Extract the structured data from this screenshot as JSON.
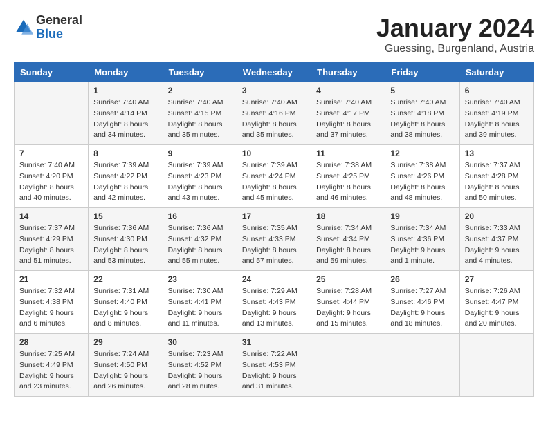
{
  "header": {
    "logo_general": "General",
    "logo_blue": "Blue",
    "month_title": "January 2024",
    "subtitle": "Guessing, Burgenland, Austria"
  },
  "days_of_week": [
    "Sunday",
    "Monday",
    "Tuesday",
    "Wednesday",
    "Thursday",
    "Friday",
    "Saturday"
  ],
  "weeks": [
    [
      {
        "day": "",
        "sunrise": "",
        "sunset": "",
        "daylight": ""
      },
      {
        "day": "1",
        "sunrise": "Sunrise: 7:40 AM",
        "sunset": "Sunset: 4:14 PM",
        "daylight": "Daylight: 8 hours and 34 minutes."
      },
      {
        "day": "2",
        "sunrise": "Sunrise: 7:40 AM",
        "sunset": "Sunset: 4:15 PM",
        "daylight": "Daylight: 8 hours and 35 minutes."
      },
      {
        "day": "3",
        "sunrise": "Sunrise: 7:40 AM",
        "sunset": "Sunset: 4:16 PM",
        "daylight": "Daylight: 8 hours and 35 minutes."
      },
      {
        "day": "4",
        "sunrise": "Sunrise: 7:40 AM",
        "sunset": "Sunset: 4:17 PM",
        "daylight": "Daylight: 8 hours and 37 minutes."
      },
      {
        "day": "5",
        "sunrise": "Sunrise: 7:40 AM",
        "sunset": "Sunset: 4:18 PM",
        "daylight": "Daylight: 8 hours and 38 minutes."
      },
      {
        "day": "6",
        "sunrise": "Sunrise: 7:40 AM",
        "sunset": "Sunset: 4:19 PM",
        "daylight": "Daylight: 8 hours and 39 minutes."
      }
    ],
    [
      {
        "day": "7",
        "sunrise": "Sunrise: 7:40 AM",
        "sunset": "Sunset: 4:20 PM",
        "daylight": "Daylight: 8 hours and 40 minutes."
      },
      {
        "day": "8",
        "sunrise": "Sunrise: 7:39 AM",
        "sunset": "Sunset: 4:22 PM",
        "daylight": "Daylight: 8 hours and 42 minutes."
      },
      {
        "day": "9",
        "sunrise": "Sunrise: 7:39 AM",
        "sunset": "Sunset: 4:23 PM",
        "daylight": "Daylight: 8 hours and 43 minutes."
      },
      {
        "day": "10",
        "sunrise": "Sunrise: 7:39 AM",
        "sunset": "Sunset: 4:24 PM",
        "daylight": "Daylight: 8 hours and 45 minutes."
      },
      {
        "day": "11",
        "sunrise": "Sunrise: 7:38 AM",
        "sunset": "Sunset: 4:25 PM",
        "daylight": "Daylight: 8 hours and 46 minutes."
      },
      {
        "day": "12",
        "sunrise": "Sunrise: 7:38 AM",
        "sunset": "Sunset: 4:26 PM",
        "daylight": "Daylight: 8 hours and 48 minutes."
      },
      {
        "day": "13",
        "sunrise": "Sunrise: 7:37 AM",
        "sunset": "Sunset: 4:28 PM",
        "daylight": "Daylight: 8 hours and 50 minutes."
      }
    ],
    [
      {
        "day": "14",
        "sunrise": "Sunrise: 7:37 AM",
        "sunset": "Sunset: 4:29 PM",
        "daylight": "Daylight: 8 hours and 51 minutes."
      },
      {
        "day": "15",
        "sunrise": "Sunrise: 7:36 AM",
        "sunset": "Sunset: 4:30 PM",
        "daylight": "Daylight: 8 hours and 53 minutes."
      },
      {
        "day": "16",
        "sunrise": "Sunrise: 7:36 AM",
        "sunset": "Sunset: 4:32 PM",
        "daylight": "Daylight: 8 hours and 55 minutes."
      },
      {
        "day": "17",
        "sunrise": "Sunrise: 7:35 AM",
        "sunset": "Sunset: 4:33 PM",
        "daylight": "Daylight: 8 hours and 57 minutes."
      },
      {
        "day": "18",
        "sunrise": "Sunrise: 7:34 AM",
        "sunset": "Sunset: 4:34 PM",
        "daylight": "Daylight: 8 hours and 59 minutes."
      },
      {
        "day": "19",
        "sunrise": "Sunrise: 7:34 AM",
        "sunset": "Sunset: 4:36 PM",
        "daylight": "Daylight: 9 hours and 1 minute."
      },
      {
        "day": "20",
        "sunrise": "Sunrise: 7:33 AM",
        "sunset": "Sunset: 4:37 PM",
        "daylight": "Daylight: 9 hours and 4 minutes."
      }
    ],
    [
      {
        "day": "21",
        "sunrise": "Sunrise: 7:32 AM",
        "sunset": "Sunset: 4:38 PM",
        "daylight": "Daylight: 9 hours and 6 minutes."
      },
      {
        "day": "22",
        "sunrise": "Sunrise: 7:31 AM",
        "sunset": "Sunset: 4:40 PM",
        "daylight": "Daylight: 9 hours and 8 minutes."
      },
      {
        "day": "23",
        "sunrise": "Sunrise: 7:30 AM",
        "sunset": "Sunset: 4:41 PM",
        "daylight": "Daylight: 9 hours and 11 minutes."
      },
      {
        "day": "24",
        "sunrise": "Sunrise: 7:29 AM",
        "sunset": "Sunset: 4:43 PM",
        "daylight": "Daylight: 9 hours and 13 minutes."
      },
      {
        "day": "25",
        "sunrise": "Sunrise: 7:28 AM",
        "sunset": "Sunset: 4:44 PM",
        "daylight": "Daylight: 9 hours and 15 minutes."
      },
      {
        "day": "26",
        "sunrise": "Sunrise: 7:27 AM",
        "sunset": "Sunset: 4:46 PM",
        "daylight": "Daylight: 9 hours and 18 minutes."
      },
      {
        "day": "27",
        "sunrise": "Sunrise: 7:26 AM",
        "sunset": "Sunset: 4:47 PM",
        "daylight": "Daylight: 9 hours and 20 minutes."
      }
    ],
    [
      {
        "day": "28",
        "sunrise": "Sunrise: 7:25 AM",
        "sunset": "Sunset: 4:49 PM",
        "daylight": "Daylight: 9 hours and 23 minutes."
      },
      {
        "day": "29",
        "sunrise": "Sunrise: 7:24 AM",
        "sunset": "Sunset: 4:50 PM",
        "daylight": "Daylight: 9 hours and 26 minutes."
      },
      {
        "day": "30",
        "sunrise": "Sunrise: 7:23 AM",
        "sunset": "Sunset: 4:52 PM",
        "daylight": "Daylight: 9 hours and 28 minutes."
      },
      {
        "day": "31",
        "sunrise": "Sunrise: 7:22 AM",
        "sunset": "Sunset: 4:53 PM",
        "daylight": "Daylight: 9 hours and 31 minutes."
      },
      {
        "day": "",
        "sunrise": "",
        "sunset": "",
        "daylight": ""
      },
      {
        "day": "",
        "sunrise": "",
        "sunset": "",
        "daylight": ""
      },
      {
        "day": "",
        "sunrise": "",
        "sunset": "",
        "daylight": ""
      }
    ]
  ]
}
